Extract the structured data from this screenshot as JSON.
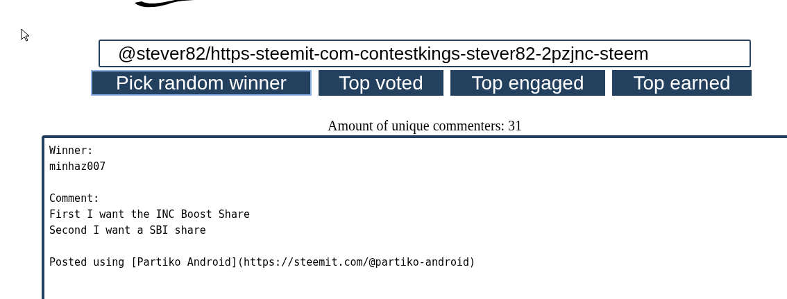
{
  "post_field": {
    "value": "@stever82/https-steemit-com-contestkings-stever82-2pzjnc-steem"
  },
  "buttons": [
    {
      "label": "Pick random winner",
      "focused": true
    },
    {
      "label": "Top voted",
      "focused": false
    },
    {
      "label": "Top engaged",
      "focused": false
    },
    {
      "label": "Top earned",
      "focused": false
    }
  ],
  "commenters_count": "Amount of unique commenters: 31",
  "output_blocks": [
    {
      "lines": [
        "Winner:",
        "minhaz007"
      ]
    },
    {
      "lines": [
        "Comment:",
        "First I want the INC Boost Share",
        "Second I want a SBI share"
      ]
    },
    {
      "lines": [
        "Posted using [Partiko Android](https://steemit.com/@partiko-android)"
      ]
    }
  ]
}
